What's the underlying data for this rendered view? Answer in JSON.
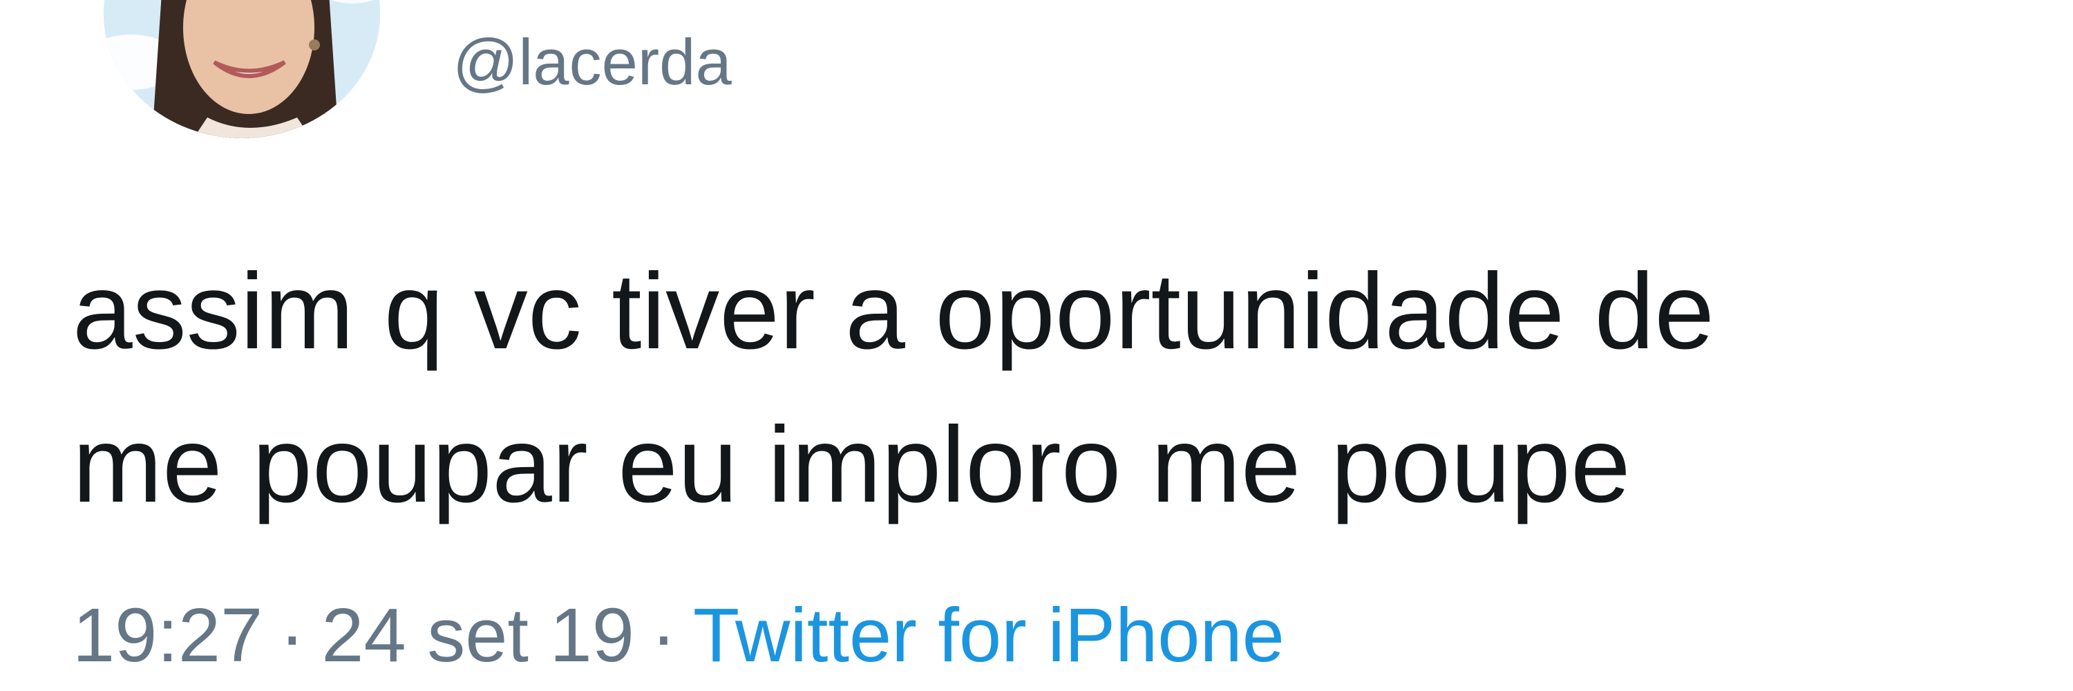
{
  "tweet": {
    "handle": "@lacerda",
    "text_lines": [
      "assim q vc tiver a oportunidade de",
      "me poupar eu imploro me poupe"
    ],
    "time": "19:27",
    "date": "24 set 19",
    "separator": "·",
    "source": "Twitter for iPhone"
  },
  "colors": {
    "text": "#14171a",
    "secondary": "#657786",
    "link": "#1b95e0",
    "background": "#ffffff"
  }
}
